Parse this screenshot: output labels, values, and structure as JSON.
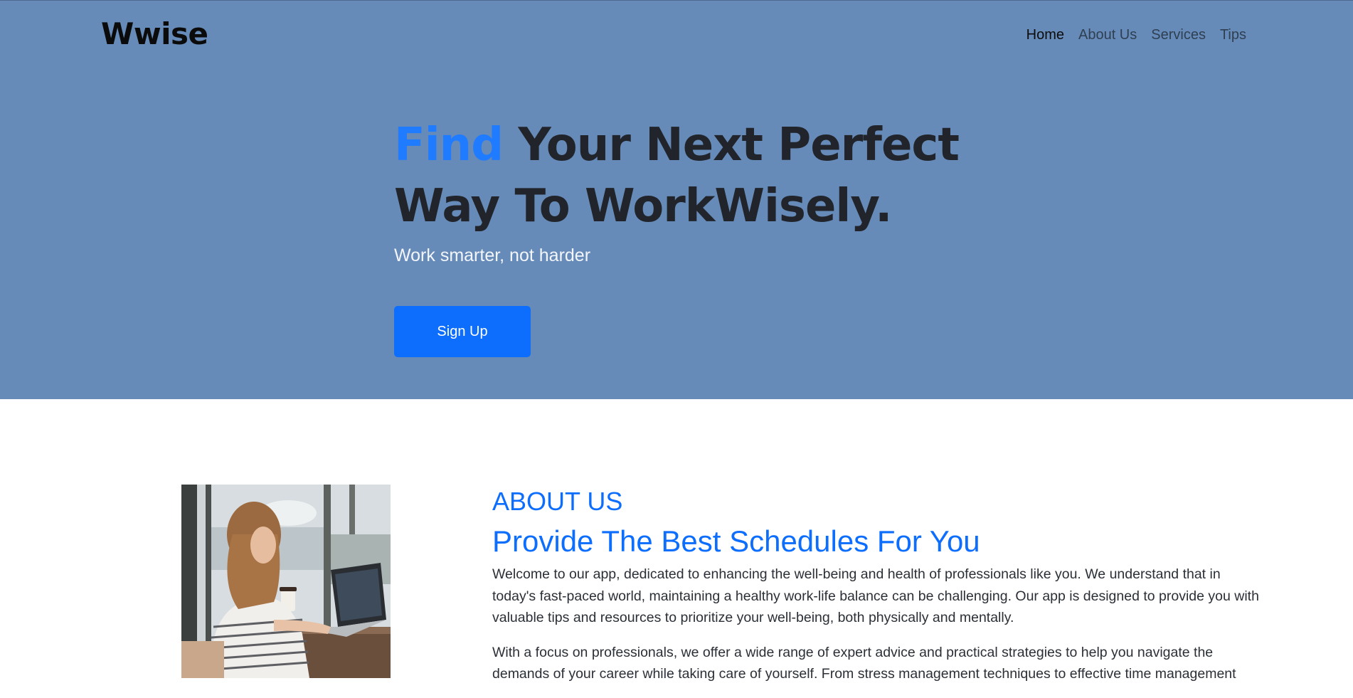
{
  "brand": "Wwise",
  "nav": [
    {
      "label": "Home",
      "active": true
    },
    {
      "label": "About Us",
      "active": false
    },
    {
      "label": "Services",
      "active": false
    },
    {
      "label": "Tips",
      "active": false
    }
  ],
  "hero": {
    "headline_accent": "Find",
    "headline_rest": " Your Next Perfect Way To WorkWisely.",
    "subtitle": "Work smarter, not harder",
    "cta_label": "Sign Up"
  },
  "about": {
    "tag": "ABOUT US",
    "title": "Provide The Best Schedules For You",
    "paragraph1": "Welcome to our app, dedicated to enhancing the well-being and health of professionals like you. We understand that in today's fast-paced world, maintaining a healthy work-life balance can be challenging. Our app is designed to provide you with valuable tips and resources to prioritize your well-being, both physically and mentally.",
    "paragraph2": "With a focus on professionals, we offer a wide range of expert advice and practical strategies to help you navigate the demands of your career while taking care of yourself. From stress management techniques to effective time management"
  },
  "colors": {
    "hero_bg": "#678bb8",
    "accent": "#0d6efd",
    "headline_accent": "#1f7bff"
  }
}
